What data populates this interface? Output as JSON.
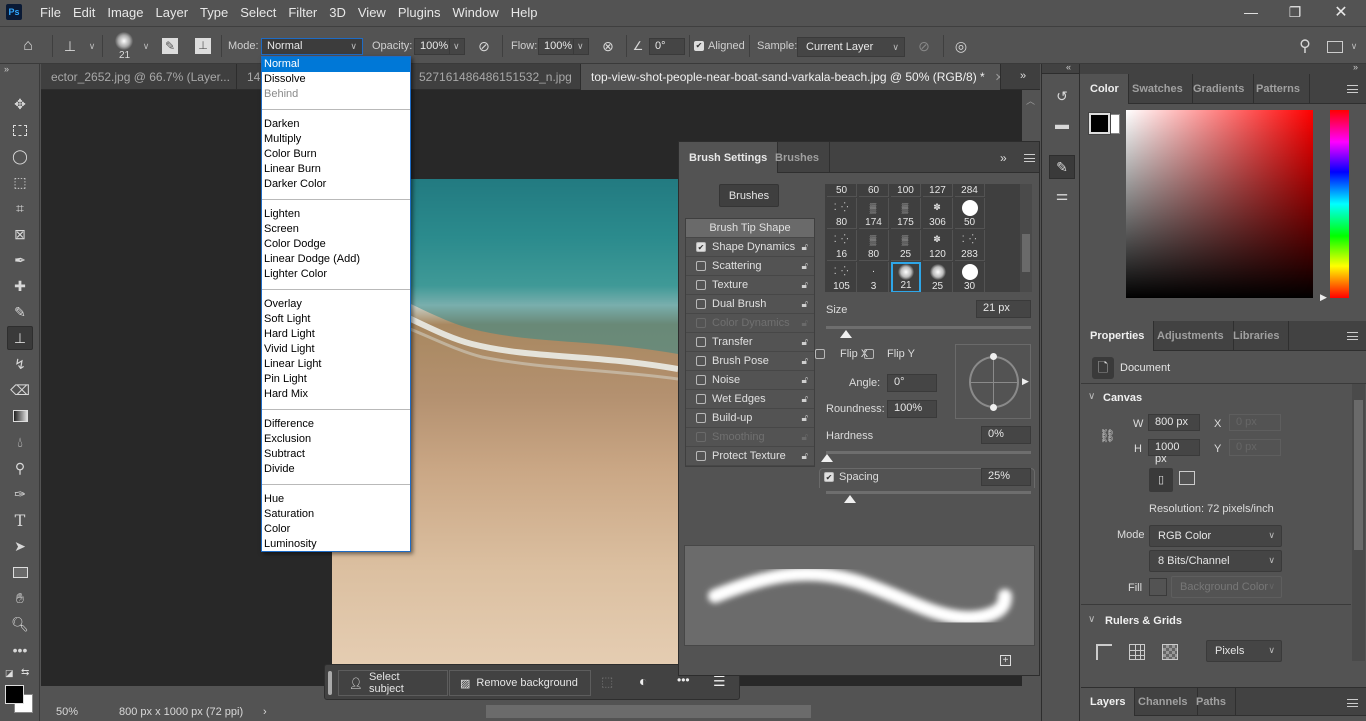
{
  "app": {
    "logo": "Ps"
  },
  "menu": [
    "File",
    "Edit",
    "Image",
    "Layer",
    "Type",
    "Select",
    "Filter",
    "3D",
    "View",
    "Plugins",
    "Window",
    "Help"
  ],
  "window_controls": {
    "minimize": "—",
    "restore": "❐",
    "close": "✕"
  },
  "options_bar": {
    "brush_size": "21",
    "mode_label": "Mode:",
    "mode_value": "Normal",
    "opacity_label": "Opacity:",
    "opacity_value": "100%",
    "flow_label": "Flow:",
    "flow_value": "100%",
    "angle_value": "0°",
    "aligned_label": "Aligned",
    "aligned_checked": true,
    "sample_label": "Sample:",
    "sample_value": "Current Layer"
  },
  "doc_tabs": [
    {
      "label": "ector_2652.jpg @ 66.7% (Layer...",
      "active": false
    },
    {
      "label": "14",
      "active": false
    },
    {
      "label": "527161486486151532_n.jpg",
      "active": false
    },
    {
      "label": "top-view-shot-people-near-boat-sand-varkala-beach.jpg @ 50% (RGB/8) *",
      "active": true
    }
  ],
  "mode_dropdown": {
    "groups": [
      [
        {
          "label": "Normal",
          "selected": true
        },
        {
          "label": "Dissolve"
        },
        {
          "label": "Behind",
          "disabled": true
        }
      ],
      [
        {
          "label": "Darken"
        },
        {
          "label": "Multiply"
        },
        {
          "label": "Color Burn"
        },
        {
          "label": "Linear Burn"
        },
        {
          "label": "Darker Color"
        }
      ],
      [
        {
          "label": "Lighten"
        },
        {
          "label": "Screen"
        },
        {
          "label": "Color Dodge"
        },
        {
          "label": "Linear Dodge (Add)"
        },
        {
          "label": "Lighter Color"
        }
      ],
      [
        {
          "label": "Overlay"
        },
        {
          "label": "Soft Light"
        },
        {
          "label": "Hard Light"
        },
        {
          "label": "Vivid Light"
        },
        {
          "label": "Linear Light"
        },
        {
          "label": "Pin Light"
        },
        {
          "label": "Hard Mix"
        }
      ],
      [
        {
          "label": "Difference"
        },
        {
          "label": "Exclusion"
        },
        {
          "label": "Subtract"
        },
        {
          "label": "Divide"
        }
      ],
      [
        {
          "label": "Hue"
        },
        {
          "label": "Saturation"
        },
        {
          "label": "Color"
        },
        {
          "label": "Luminosity"
        }
      ]
    ]
  },
  "brush_panel": {
    "tabs": [
      "Brush Settings",
      "Brushes"
    ],
    "brushes_button": "Brushes",
    "options": [
      {
        "label": "Brush Tip Shape",
        "header": true
      },
      {
        "label": "Shape Dynamics",
        "checked": true
      },
      {
        "label": "Scattering",
        "checked": false
      },
      {
        "label": "Texture",
        "checked": false
      },
      {
        "label": "Dual Brush",
        "checked": false
      },
      {
        "label": "Color Dynamics",
        "checked": false,
        "disabled": true
      },
      {
        "label": "Transfer",
        "checked": false
      },
      {
        "label": "Brush Pose",
        "checked": false
      },
      {
        "label": "Noise",
        "checked": false
      },
      {
        "label": "Wet Edges",
        "checked": false
      },
      {
        "label": "Build-up",
        "checked": false
      },
      {
        "label": "Smoothing",
        "checked": false,
        "disabled": true
      },
      {
        "label": "Protect Texture",
        "checked": false
      }
    ],
    "tips": [
      {
        "size": "50",
        "type": "top"
      },
      {
        "size": "60",
        "type": "top"
      },
      {
        "size": "100",
        "type": "top"
      },
      {
        "size": "127",
        "type": "top"
      },
      {
        "size": "284",
        "type": "top"
      },
      {
        "size": "80",
        "type": "speck"
      },
      {
        "size": "174",
        "type": "texture"
      },
      {
        "size": "175",
        "type": "texture"
      },
      {
        "size": "306",
        "type": "leaf"
      },
      {
        "size": "50",
        "type": "hard"
      },
      {
        "size": "16",
        "type": "speck"
      },
      {
        "size": "80",
        "type": "texture"
      },
      {
        "size": "25",
        "type": "texture"
      },
      {
        "size": "120",
        "type": "leaf"
      },
      {
        "size": "283",
        "type": "speck"
      },
      {
        "size": "105",
        "type": "speck"
      },
      {
        "size": "3",
        "type": "dot"
      },
      {
        "size": "21",
        "type": "soft",
        "selected": true
      },
      {
        "size": "25",
        "type": "soft"
      },
      {
        "size": "30",
        "type": "hard"
      }
    ],
    "size_label": "Size",
    "size_value": "21 px",
    "flip_x": "Flip X",
    "flip_y": "Flip Y",
    "angle_label": "Angle:",
    "angle_value": "0°",
    "roundness_label": "Roundness:",
    "roundness_value": "100%",
    "hardness_label": "Hardness",
    "hardness_value": "0%",
    "spacing_label": "Spacing",
    "spacing_value": "25%",
    "spacing_checked": true
  },
  "task_bar": {
    "select_subject": "Select subject",
    "remove_background": "Remove background"
  },
  "status_bar": {
    "zoom": "50%",
    "doc_info": "800 px x 1000 px (72 ppi)"
  },
  "color_panel": {
    "tabs": [
      "Color",
      "Swatches",
      "Gradients",
      "Patterns"
    ],
    "foreground": "#000000",
    "background": "#ffffff",
    "hue": "#ff0000"
  },
  "properties_panel": {
    "tabs": [
      "Properties",
      "Adjustments",
      "Libraries"
    ],
    "doc_label": "Document",
    "canvas_title": "Canvas",
    "w_label": "W",
    "w_value": "800 px",
    "h_label": "H",
    "h_value": "1000 px",
    "x_label": "X",
    "x_value": "0 px",
    "y_label": "Y",
    "y_value": "0 px",
    "resolution": "Resolution: 72 pixels/inch",
    "mode_label": "Mode",
    "mode_value": "RGB Color",
    "depth_value": "8 Bits/Channel",
    "fill_label": "Fill",
    "fill_value": "Background Color",
    "rulers_title": "Rulers & Grids",
    "units_value": "Pixels"
  },
  "layers_panel": {
    "tabs": [
      "Layers",
      "Channels",
      "Paths"
    ]
  }
}
